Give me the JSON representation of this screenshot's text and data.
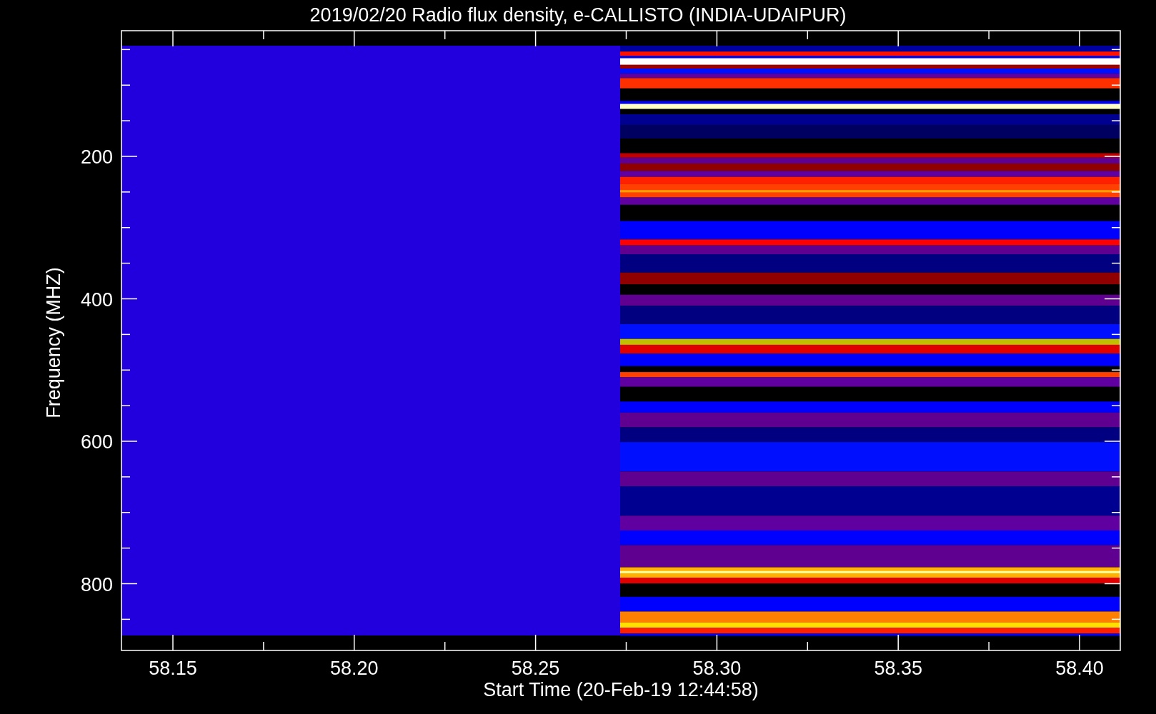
{
  "title": "2019/02/20  Radio flux density, e-CALLISTO (INDIA-UDAIPUR)",
  "y_axis": {
    "label": "Frequency (MHZ)",
    "tick_labels": [
      "200",
      "400",
      "600",
      "800"
    ]
  },
  "x_axis": {
    "label": "Start Time (20-Feb-19 12:44:58)",
    "tick_labels": [
      "58.15",
      "58.20",
      "58.25",
      "58.30",
      "58.35",
      "58.40"
    ]
  }
}
